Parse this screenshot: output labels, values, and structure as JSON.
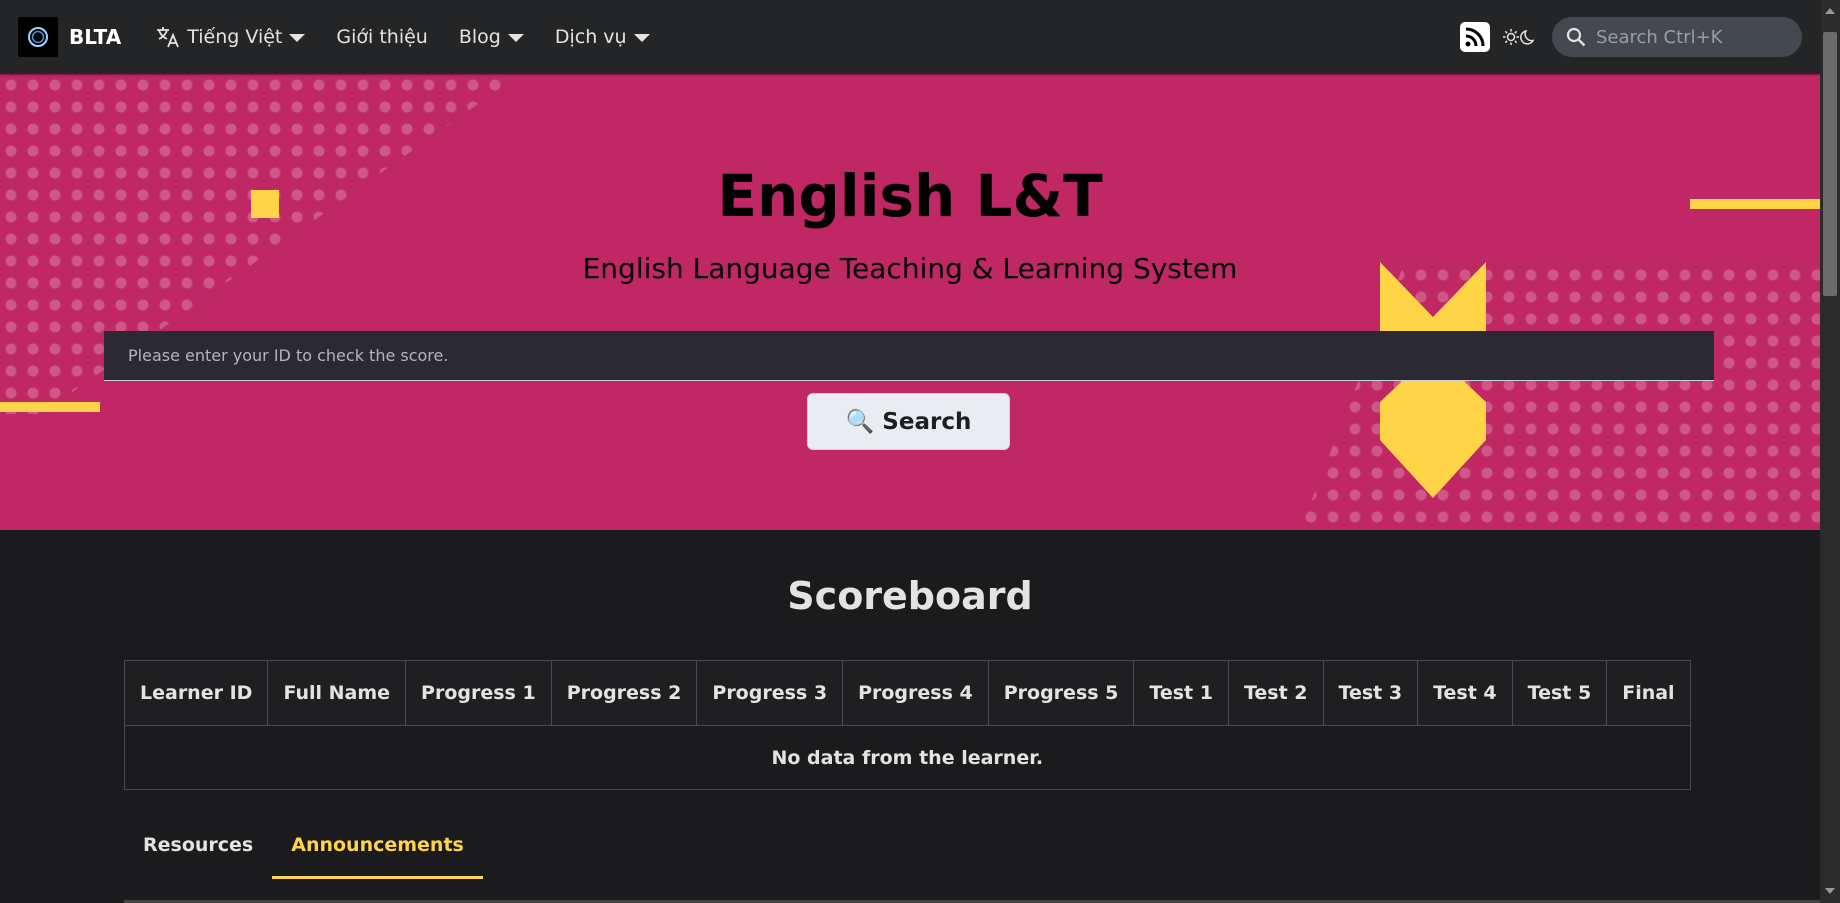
{
  "navbar": {
    "brand": "BLTA",
    "items": [
      {
        "label": "Tiếng Việt",
        "icon": "translate-icon",
        "dropdown": true
      },
      {
        "label": "Giới thiệu",
        "dropdown": false
      },
      {
        "label": "Blog",
        "dropdown": true
      },
      {
        "label": "Dịch vụ",
        "dropdown": true
      }
    ],
    "search_placeholder": "Search Ctrl+K"
  },
  "hero": {
    "title": "English L&T",
    "subtitle": "English Language Teaching & Learning System",
    "id_placeholder": "Please enter your ID to check the score.",
    "search_button": "Search",
    "search_emoji": "🔍"
  },
  "scoreboard": {
    "title": "Scoreboard",
    "columns": [
      "Learner ID",
      "Full Name",
      "Progress 1",
      "Progress 2",
      "Progress 3",
      "Progress 4",
      "Progress 5",
      "Test 1",
      "Test 2",
      "Test 3",
      "Test 4",
      "Test 5",
      "Final"
    ],
    "empty_message": "No data from the learner."
  },
  "tabs": [
    {
      "label": "Resources",
      "active": false
    },
    {
      "label": "Announcements",
      "active": true
    }
  ],
  "colors": {
    "hero_bg": "#bf2864",
    "accent_yellow": "#ffd447",
    "navbar_bg": "#242526",
    "page_bg": "#1b1b1d"
  }
}
